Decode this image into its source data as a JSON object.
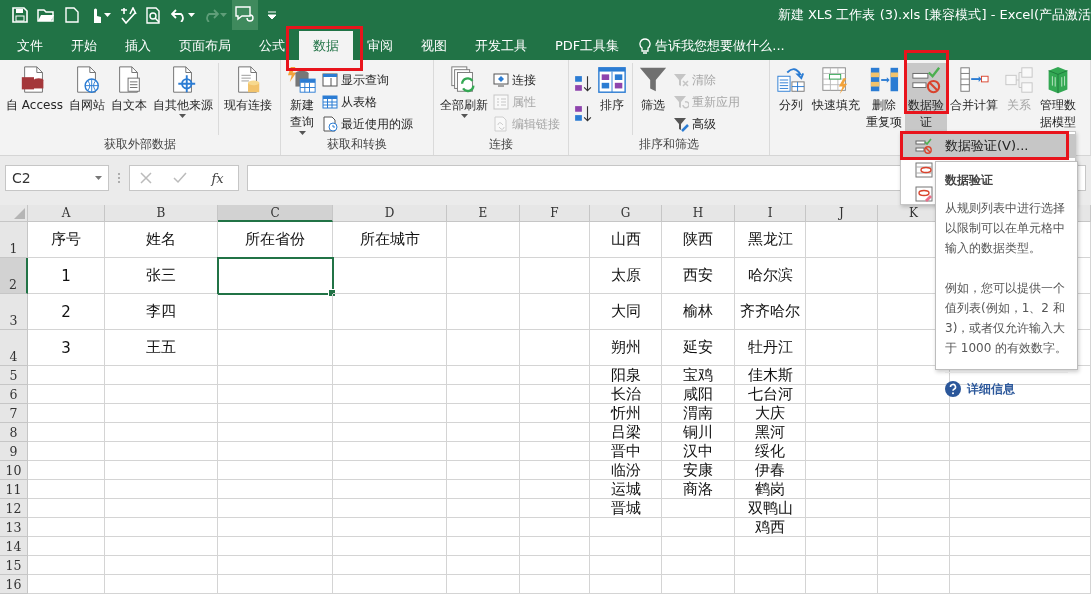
{
  "window": {
    "title": "新建 XLS 工作表 (3).xls  [兼容模式] - Excel(产品激活"
  },
  "tabs": [
    {
      "label": "文件",
      "selected": false
    },
    {
      "label": "开始",
      "selected": false
    },
    {
      "label": "插入",
      "selected": false
    },
    {
      "label": "页面布局",
      "selected": false
    },
    {
      "label": "公式",
      "selected": false
    },
    {
      "label": "数据",
      "selected": true
    },
    {
      "label": "审阅",
      "selected": false
    },
    {
      "label": "视图",
      "selected": false
    },
    {
      "label": "开发工具",
      "selected": false
    },
    {
      "label": "PDF工具集",
      "selected": false
    }
  ],
  "tell_me": "告诉我您想要做什么...",
  "ribbon": {
    "groups": [
      {
        "label": "获取外部数据",
        "sections": [
          [
            {
              "kind": "large",
              "lines": [
                "自 Access"
              ],
              "disabled": false,
              "dropdown": false,
              "pressed": false
            },
            {
              "kind": "large",
              "lines": [
                "自网站"
              ],
              "disabled": false,
              "dropdown": false,
              "pressed": false
            },
            {
              "kind": "large",
              "lines": [
                "自文本"
              ],
              "disabled": false,
              "dropdown": false,
              "pressed": false
            },
            {
              "kind": "large",
              "lines": [
                "自其他来源"
              ],
              "disabled": false,
              "dropdown": true,
              "pressed": false
            }
          ],
          [
            {
              "kind": "large",
              "lines": [
                "现有连接"
              ],
              "disabled": false,
              "dropdown": false,
              "pressed": false
            }
          ]
        ]
      },
      {
        "label": "获取和转换",
        "sections": [
          [
            {
              "kind": "large",
              "lines": [
                "新建",
                "查询"
              ],
              "disabled": false,
              "dropdown": true,
              "pressed": false
            },
            {
              "kind": "small",
              "lines": [
                "显示查询"
              ],
              "disabled": false,
              "dropdown": false,
              "pressed": false
            },
            {
              "kind": "small",
              "lines": [
                "从表格"
              ],
              "disabled": false,
              "dropdown": false,
              "pressed": false
            },
            {
              "kind": "small",
              "lines": [
                "最近使用的源"
              ],
              "disabled": false,
              "dropdown": false,
              "pressed": false
            }
          ]
        ]
      },
      {
        "label": "连接",
        "sections": [
          [
            {
              "kind": "large",
              "lines": [
                "全部刷新"
              ],
              "disabled": false,
              "dropdown": true,
              "pressed": false
            },
            {
              "kind": "small",
              "lines": [
                "连接"
              ],
              "disabled": false,
              "dropdown": false,
              "pressed": false
            },
            {
              "kind": "small",
              "lines": [
                "属性"
              ],
              "disabled": true,
              "dropdown": false,
              "pressed": false
            },
            {
              "kind": "small",
              "lines": [
                "编辑链接"
              ],
              "disabled": true,
              "dropdown": false,
              "pressed": false
            }
          ]
        ]
      },
      {
        "label": "排序和筛选",
        "sections": [
          [
            {
              "kind": "icon",
              "disabled": false,
              "dropdown": false,
              "pressed": false
            },
            {
              "kind": "icon",
              "disabled": false,
              "dropdown": false,
              "pressed": false
            },
            {
              "kind": "large",
              "lines": [
                "排序"
              ],
              "disabled": false,
              "dropdown": false,
              "pressed": false
            }
          ],
          [
            {
              "kind": "large",
              "lines": [
                "筛选"
              ],
              "disabled": false,
              "dropdown": false,
              "pressed": false
            },
            {
              "kind": "small",
              "lines": [
                "清除"
              ],
              "disabled": true,
              "dropdown": false,
              "pressed": false
            },
            {
              "kind": "small",
              "lines": [
                "重新应用"
              ],
              "disabled": true,
              "dropdown": false,
              "pressed": false
            },
            {
              "kind": "small",
              "lines": [
                "高级"
              ],
              "disabled": false,
              "dropdown": false,
              "pressed": false
            }
          ]
        ]
      },
      {
        "sections": [
          [
            {
              "kind": "large",
              "lines": [
                "分列"
              ],
              "disabled": false,
              "dropdown": false,
              "pressed": false
            },
            {
              "kind": "large",
              "lines": [
                "快速填充"
              ],
              "disabled": false,
              "dropdown": false,
              "pressed": false
            },
            {
              "kind": "large",
              "lines": [
                "删除",
                "重复项"
              ],
              "disabled": false,
              "dropdown": false,
              "pressed": false
            },
            {
              "kind": "large",
              "lines": [
                "数据验",
                "证"
              ],
              "disabled": false,
              "dropdown": true,
              "pressed": true
            },
            {
              "kind": "large",
              "lines": [
                "合并计算"
              ],
              "disabled": false,
              "dropdown": false,
              "pressed": false
            },
            {
              "kind": "large",
              "lines": [
                "关系"
              ],
              "disabled": true,
              "dropdown": false,
              "pressed": false
            },
            {
              "kind": "large",
              "lines": [
                "管理数",
                "据模型"
              ],
              "disabled": false,
              "dropdown": false,
              "pressed": false
            }
          ]
        ]
      }
    ]
  },
  "formula_bar": {
    "name_box": "C2",
    "function_button": "fx"
  },
  "sheet": {
    "columns": [
      {
        "label": "A",
        "selected": false
      },
      {
        "label": "B",
        "selected": false
      },
      {
        "label": "C",
        "selected": true
      },
      {
        "label": "D",
        "selected": false
      },
      {
        "label": "E",
        "selected": false
      },
      {
        "label": "F",
        "selected": false
      },
      {
        "label": "G",
        "selected": false
      },
      {
        "label": "H",
        "selected": false
      },
      {
        "label": "I",
        "selected": false
      },
      {
        "label": "J",
        "selected": false
      },
      {
        "label": "K",
        "selected": false
      }
    ],
    "rows": [
      {
        "label": "1",
        "selected": false,
        "cells": {
          "A": "序号",
          "B": "姓名",
          "C": "所在省份",
          "D": "所在城市",
          "G": "山西",
          "H": "陕西",
          "I": "黑龙江"
        }
      },
      {
        "label": "2",
        "selected": true,
        "cells": {
          "A": "1",
          "B": "张三",
          "G": "太原",
          "H": "西安",
          "I": "哈尔滨"
        }
      },
      {
        "label": "3",
        "selected": false,
        "cells": {
          "A": "2",
          "B": "李四",
          "G": "大同",
          "H": "榆林",
          "I": "齐齐哈尔"
        }
      },
      {
        "label": "4",
        "selected": false,
        "cells": {
          "A": "3",
          "B": "王五",
          "G": "朔州",
          "H": "延安",
          "I": "牡丹江"
        }
      },
      {
        "label": "5",
        "selected": false,
        "cells": {
          "G": "阳泉",
          "H": "宝鸡",
          "I": "佳木斯"
        }
      },
      {
        "label": "6",
        "selected": false,
        "cells": {
          "G": "长治",
          "H": "咸阳",
          "I": "七台河"
        }
      },
      {
        "label": "7",
        "selected": false,
        "cells": {
          "G": "忻州",
          "H": "渭南",
          "I": "大庆"
        }
      },
      {
        "label": "8",
        "selected": false,
        "cells": {
          "G": "吕梁",
          "H": "铜川",
          "I": "黑河"
        }
      },
      {
        "label": "9",
        "selected": false,
        "cells": {
          "G": "晋中",
          "H": "汉中",
          "I": "绥化"
        }
      },
      {
        "label": "10",
        "selected": false,
        "cells": {
          "G": "临汾",
          "H": "安康",
          "I": "伊春"
        }
      },
      {
        "label": "11",
        "selected": false,
        "cells": {
          "G": "运城",
          "H": "商洛",
          "I": "鹤岗"
        }
      },
      {
        "label": "12",
        "selected": false,
        "cells": {
          "G": "晋城",
          "I": "双鸭山"
        }
      },
      {
        "label": "13",
        "selected": false,
        "cells": {
          "I": "鸡西"
        }
      },
      {
        "label": "14",
        "selected": false
      },
      {
        "label": "15",
        "selected": false
      },
      {
        "label": "16",
        "selected": false
      }
    ]
  },
  "validation_menu": {
    "items": [
      {
        "label": "数据验证(V)...",
        "selected": true
      },
      {
        "selected": false
      },
      {
        "selected": false
      }
    ]
  },
  "tooltip": {
    "title": "数据验证",
    "paragraphs": [
      "从规则列表中进行选择以限制可以在单元格中输入的数据类型。",
      "例如，您可以提供一个值列表(例如，1、2 和 3)，或者仅允许输入大于 1000 的有效数字。"
    ],
    "link": "详细信息"
  }
}
